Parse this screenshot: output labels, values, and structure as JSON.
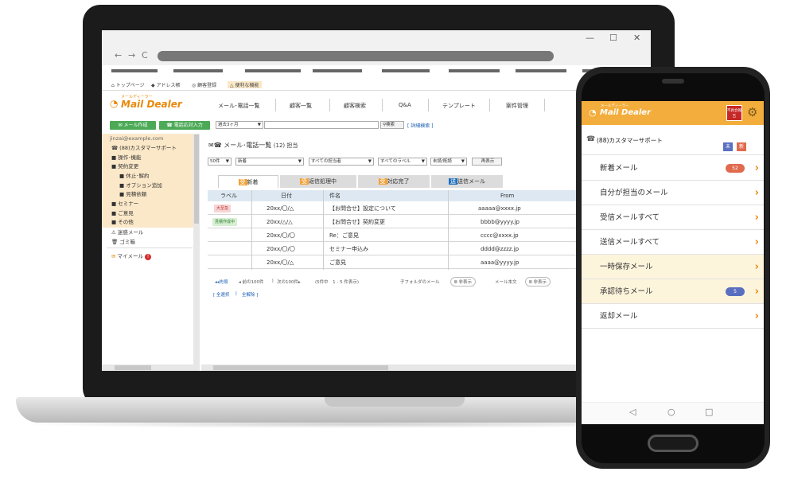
{
  "browser": {
    "window_controls": {
      "minimize": "—",
      "maximize": "☐",
      "close": "✕"
    },
    "nav": {
      "back": "←",
      "forward": "→",
      "reload": "C"
    }
  },
  "app": {
    "top_links": [
      "トップページ",
      "アドレス帳",
      "顧客登録",
      "便利な機能"
    ],
    "logo_text": "Mail Dealer",
    "logo_sub": "メールディーラー",
    "menu": [
      "メール･電話一覧",
      "顧客一覧",
      "顧客検索",
      "Q&A",
      "テンプレート",
      "案件管理"
    ],
    "buttons": {
      "compose": "メール作成",
      "phone": "電話応対入力"
    },
    "search": {
      "period": "過去3ヶ月",
      "search_button": "検索",
      "advanced": "[ 詳細検索 ]"
    },
    "sidebar": {
      "account": "jinzai@example.com",
      "items": [
        "(88)カスタマーサポート",
        "操作･機能",
        "契約変更",
        "休止･解約",
        "オプション追加",
        "見積依頼",
        "セミナー",
        "ご意見",
        "その他",
        "迷惑メール",
        "ゴミ箱",
        "マイメール"
      ],
      "mymail_badge": "!"
    },
    "list": {
      "title": "メール･電話一覧",
      "count": "(12) 担当",
      "filters": [
        "50件",
        "新着",
        "すべての担当者",
        "すべてのラベル",
        "未読/既読",
        "再表示"
      ],
      "tabs": [
        {
          "icon": "受",
          "label": "新着"
        },
        {
          "icon": "受",
          "label": "返信処理中"
        },
        {
          "icon": "受",
          "label": "対応完了"
        },
        {
          "icon": "送",
          "label": "送信メール"
        }
      ],
      "columns": [
        "ラベル",
        "日付",
        "件名",
        "From"
      ],
      "rows": [
        {
          "label": "大至急",
          "date": "20xx/〇/△",
          "subject": "【お問合せ】設定について",
          "from": "aaaaa@xxxx.jp"
        },
        {
          "label": "見積作成中",
          "date": "20xx/△/△",
          "subject": "【お問合せ】契約変更",
          "from": "bbbb@yyyy.jp"
        },
        {
          "label": "",
          "date": "20xx/〇/〇",
          "subject": "Re：ご意見",
          "from": "cccc@xxxx.jp"
        },
        {
          "label": "",
          "date": "20xx/〇/〇",
          "subject": "セミナー申込み",
          "from": "dddd@zzzz.jp"
        },
        {
          "label": "",
          "date": "20xx/〇/△",
          "subject": "ご意見",
          "from": "aaaa@yyyy.jp"
        }
      ],
      "pager": {
        "first": "◂◂先頭",
        "prev": "◂ 前の100件",
        "next": "次の100件▸",
        "range": "(5件中　1 - 5 件表示)"
      },
      "options": {
        "subfolder": "子フォルダのメール",
        "subfolder_state": "非表示",
        "body": "メール本文",
        "body_state": "非表示"
      },
      "select": {
        "all": "[ 全選択",
        "none": "全解除 ]"
      }
    }
  },
  "phone": {
    "logo_text": "Mail Dealer",
    "logo_sub": "メールディーラー",
    "alert_box": "不具合報告",
    "folder": "(88)カスタマーサポート",
    "folder_tags": [
      "未",
      "新"
    ],
    "items": [
      {
        "label": "新着メール",
        "badge": "52",
        "highlight": false
      },
      {
        "label": "自分が担当のメール",
        "badge": "",
        "highlight": false
      },
      {
        "label": "受信メールすべて",
        "badge": "",
        "highlight": false
      },
      {
        "label": "送信メールすべて",
        "badge": "",
        "highlight": false
      },
      {
        "label": "一時保存メール",
        "badge": "",
        "highlight": true
      },
      {
        "label": "承認待ちメール",
        "badge": "5",
        "highlight": true
      },
      {
        "label": "返却メール",
        "badge": "",
        "highlight": false
      }
    ],
    "nav": {
      "back": "◁",
      "home": "○",
      "recent": "□"
    }
  },
  "colors": {
    "brand": "#e8890c",
    "header": "#f2ad3c",
    "green": "#4caa57",
    "badge_red": "#e06a4e",
    "badge_blue": "#5a6fc0"
  }
}
